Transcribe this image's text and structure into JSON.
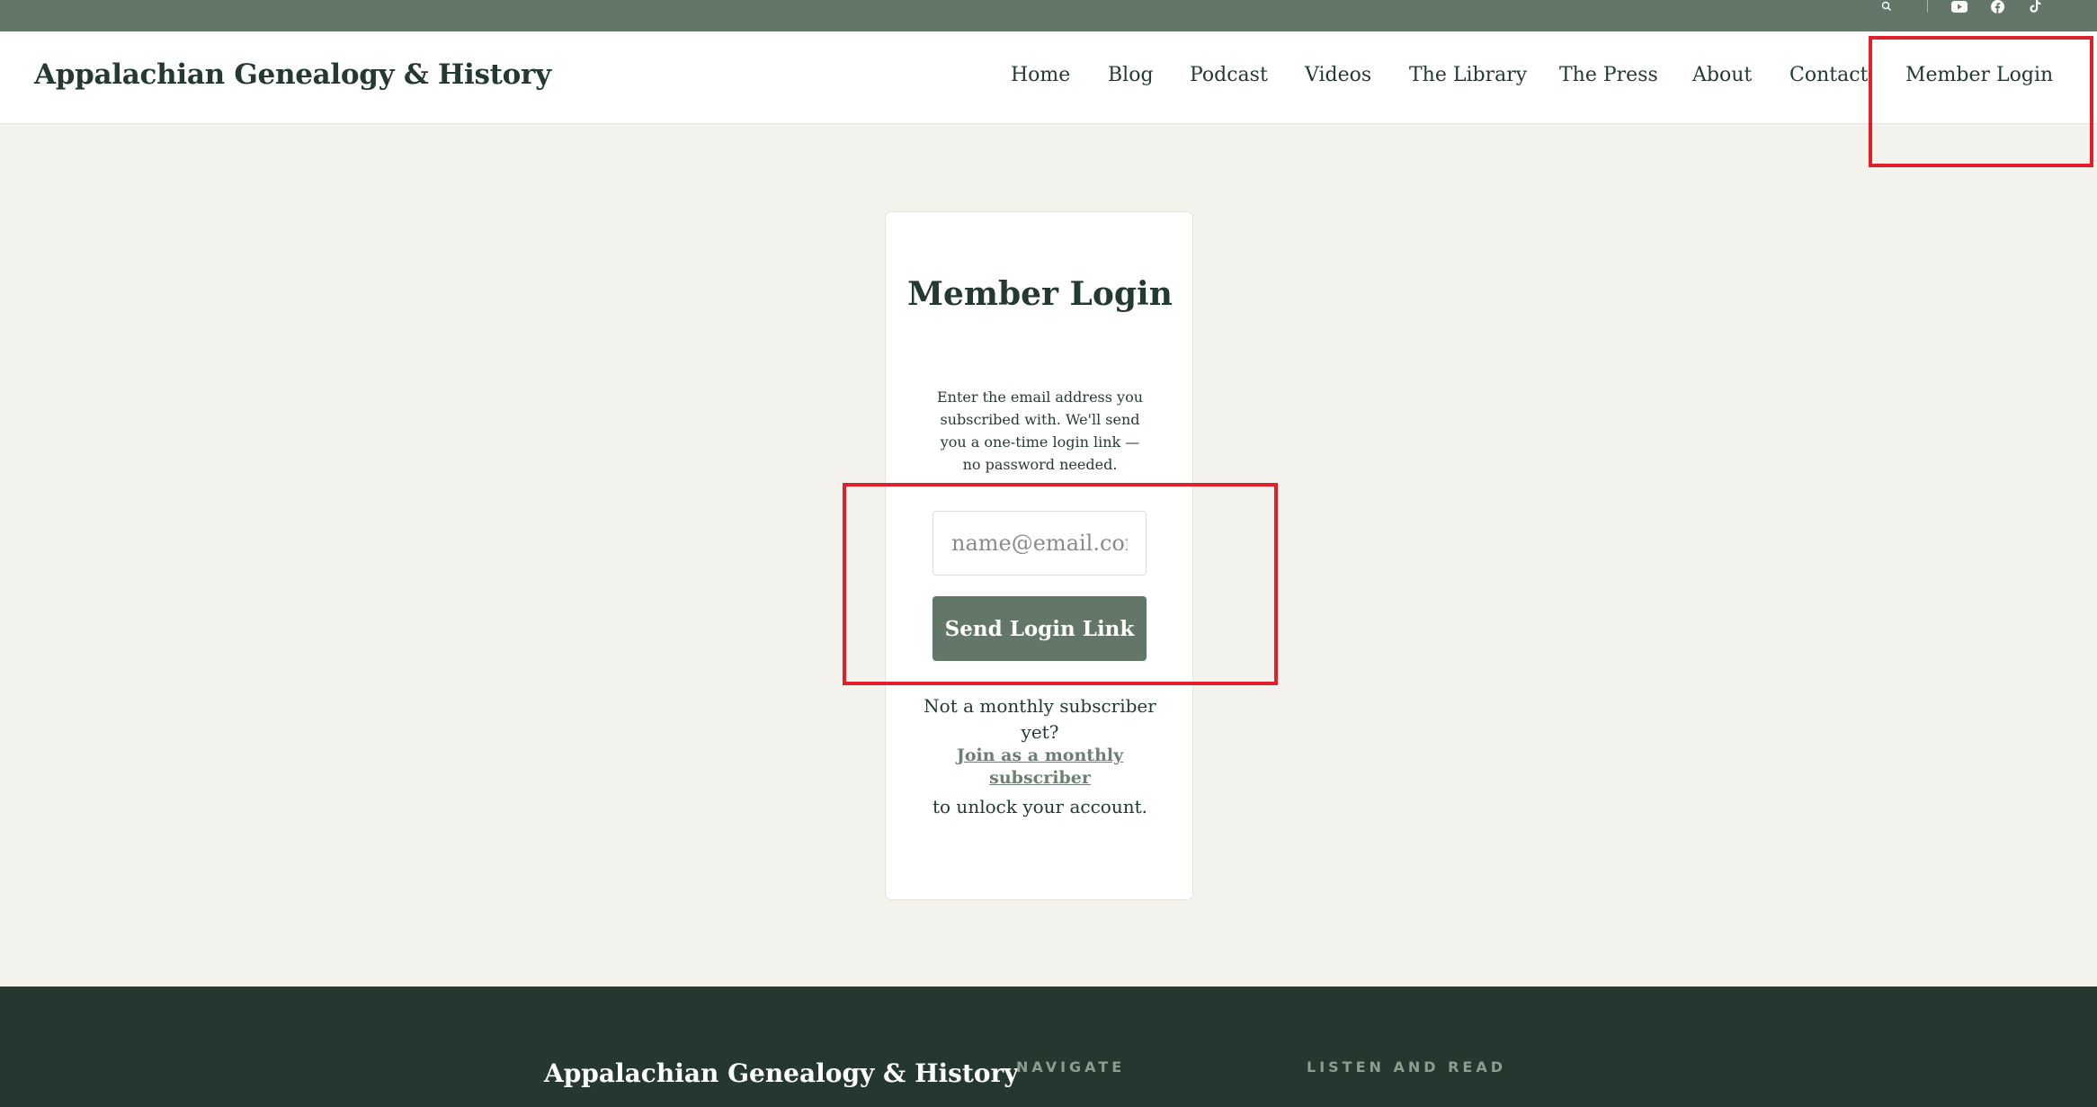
{
  "topbar": {
    "icons": [
      "search-icon",
      "youtube-icon",
      "facebook-icon",
      "tiktok-icon"
    ]
  },
  "header": {
    "brand": "Appalachian Genealogy & History",
    "nav": [
      {
        "label": "Home"
      },
      {
        "label": "Blog"
      },
      {
        "label": "Podcast"
      },
      {
        "label": "Videos"
      },
      {
        "label": "The Library"
      },
      {
        "label": "The Press"
      },
      {
        "label": "About"
      },
      {
        "label": "Contact"
      },
      {
        "label": "Member Login"
      }
    ]
  },
  "login": {
    "title": "Member Login",
    "description": "Enter the email address you subscribed with. We'll send you a one-time login link — no password needed.",
    "email_placeholder": "name@email.com",
    "email_value": "",
    "button_label": "Send Login Link",
    "not_subscriber": "Not a monthly subscriber yet?",
    "join_link": "Join as a monthly subscriber",
    "unlock_text": "to unlock your account."
  },
  "footer": {
    "brand": "Appalachian Genealogy & History",
    "headings": [
      "NAVIGATE",
      "LISTEN AND READ"
    ]
  },
  "colors": {
    "accent": "#637769",
    "dark": "#243830",
    "page_bg": "#f3f2ed",
    "highlight": "#e0202a"
  }
}
